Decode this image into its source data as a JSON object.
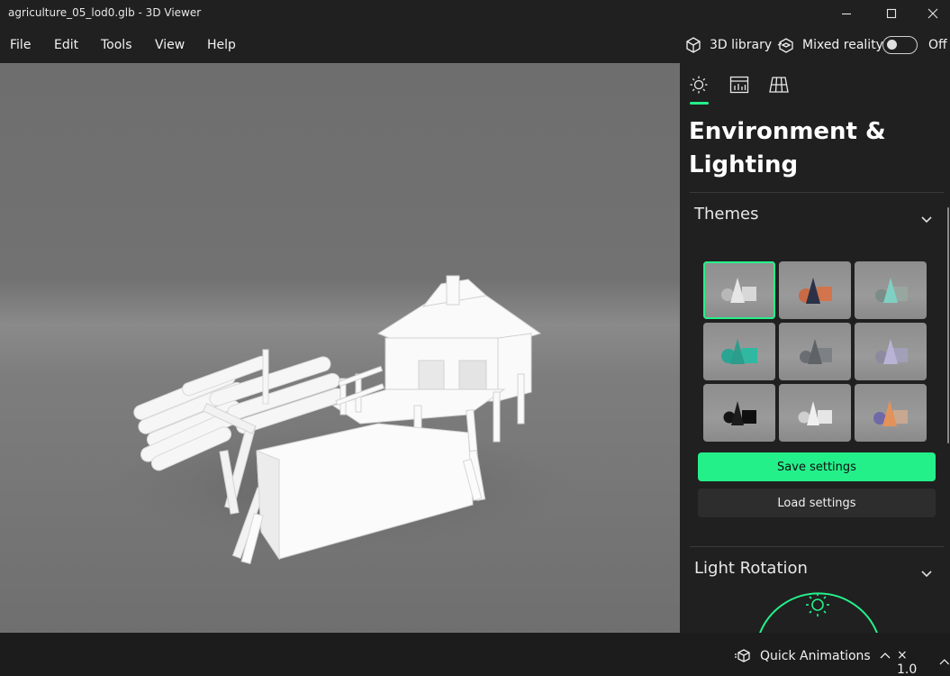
{
  "window": {
    "title": "agriculture_05_lod0.glb - 3D Viewer"
  },
  "menu": {
    "items": [
      "File",
      "Edit",
      "Tools",
      "View",
      "Help"
    ]
  },
  "topbar": {
    "library_label": "3D library",
    "mixed_reality_label": "Mixed reality",
    "toggle_state": "Off"
  },
  "panel": {
    "tabs": [
      {
        "icon": "sun-icon",
        "name": "environment"
      },
      {
        "icon": "stats-icon",
        "name": "statistics"
      },
      {
        "icon": "grid-icon",
        "name": "grid"
      }
    ],
    "title": "Environment & Lighting",
    "themes_title": "Themes",
    "themes_selected_index": 0,
    "save_label": "Save settings",
    "load_label": "Load settings",
    "light_rotation_title": "Light Rotation"
  },
  "statusbar": {
    "animations_label": "Quick Animations",
    "speed_label": "× 1.0"
  },
  "colors": {
    "accent": "#24f08a",
    "panel_bg": "#202020",
    "viewport_bg": "#787878"
  }
}
